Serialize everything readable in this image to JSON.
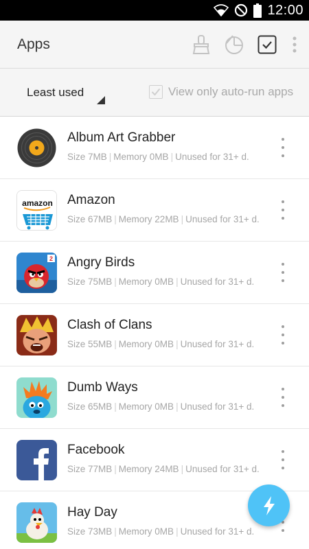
{
  "status_bar": {
    "time": "12:00",
    "icons": [
      "wifi-icon",
      "no-sim-icon",
      "battery-icon"
    ]
  },
  "app_bar": {
    "title": "Apps",
    "actions": [
      "broom-icon",
      "pie-chart-icon",
      "checkbox-icon",
      "overflow-menu-icon"
    ]
  },
  "filter": {
    "sort_value": "Least used",
    "autorun_label": "View only auto-run apps",
    "autorun_checked": true
  },
  "apps": [
    {
      "name": "Album Art Grabber",
      "size": "Size 7MB",
      "memory": "Memory 0MB",
      "unused": "Unused for 31+ d.",
      "icon": "vinyl-record-icon",
      "color": "#3d3d3d"
    },
    {
      "name": "Amazon",
      "size": "Size 67MB",
      "memory": "Memory 22MB",
      "unused": "Unused for 31+ d.",
      "icon": "amazon-icon",
      "color": "#1a98d5"
    },
    {
      "name": "Angry Birds",
      "size": "Size 75MB",
      "memory": "Memory 0MB",
      "unused": "Unused for 31+ d.",
      "icon": "angry-birds-icon",
      "color": "#2a7fc9"
    },
    {
      "name": "Clash of Clans",
      "size": "Size 55MB",
      "memory": "Memory 0MB",
      "unused": "Unused for 31+ d.",
      "icon": "clash-of-clans-icon",
      "color": "#b5472a"
    },
    {
      "name": "Dumb Ways",
      "size": "Size 65MB",
      "memory": "Memory 0MB",
      "unused": "Unused for 31+ d.",
      "icon": "dumb-ways-icon",
      "color": "#7fd6c6"
    },
    {
      "name": "Facebook",
      "size": "Size 77MB",
      "memory": "Memory 24MB",
      "unused": "Unused for 31+ d.",
      "icon": "facebook-icon",
      "color": "#3b5998"
    },
    {
      "name": "Hay Day",
      "size": "Size 73MB",
      "memory": "Memory 0MB",
      "unused": "Unused for 31+ d.",
      "icon": "hay-day-icon",
      "color": "#5fb6e8"
    }
  ],
  "fab": {
    "icon": "lightning-icon",
    "color": "#4fc3f7"
  }
}
